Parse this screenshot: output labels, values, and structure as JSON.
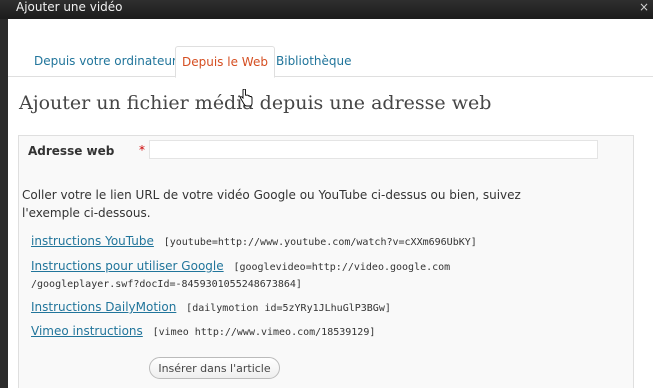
{
  "window": {
    "title": "Ajouter une vidéo",
    "close_glyph": "×"
  },
  "tabs": [
    {
      "label": "Depuis votre ordinateur",
      "active": false
    },
    {
      "label": "Depuis le Web",
      "active": true
    },
    {
      "label": "Bibliothèque",
      "active": false
    }
  ],
  "heading": "Ajouter un fichier média depuis une adresse web",
  "form": {
    "url_label": "Adresse web",
    "required_mark": "*",
    "url_value": ""
  },
  "help_text": "Coller votre le lien URL de votre vidéo Google ou YouTube ci-dessus ou bien, suivez l'exemple ci-dessous.",
  "examples": [
    {
      "link": "instructions YouTube",
      "code": "[youtube=http://www.youtube.com/watch?v=cXXm696UbKY]"
    },
    {
      "link": "Instructions pour utiliser Google",
      "code": "[googlevideo=http://video.google.com",
      "code_line2": "/googleplayer.swf?docId=-8459301055248673864]"
    },
    {
      "link": "Instructions DailyMotion",
      "code": "[dailymotion id=5zYRy1JLhuGlP3BGw]"
    },
    {
      "link": "Vimeo instructions",
      "code": "[vimeo http://www.vimeo.com/18539129]"
    }
  ],
  "insert_button": "Insérer dans l'article",
  "colors": {
    "link": "#21759b",
    "active_tab": "#d54e21",
    "required": "#cc0000"
  },
  "icons": {
    "cursor": "hand-pointer-icon",
    "close": "close-icon"
  }
}
